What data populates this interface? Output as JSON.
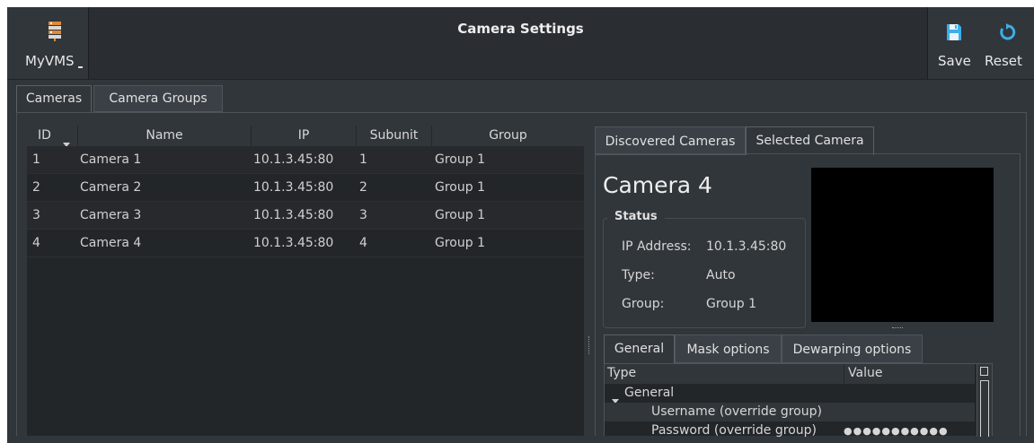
{
  "window": {
    "title": "Camera Settings"
  },
  "toolbar": {
    "app_label": "MyVMS",
    "app_icon": "server-stack-icon",
    "save_label": "Save",
    "save_icon": "floppy-save-icon",
    "reset_label": "Reset",
    "reset_icon": "reset-arrow-icon"
  },
  "main_tabs": [
    {
      "label": "Cameras",
      "active": true
    },
    {
      "label": "Camera Groups",
      "active": false
    }
  ],
  "cameras_table": {
    "columns": [
      "ID",
      "Name",
      "IP",
      "Subunit",
      "Group"
    ],
    "sort_indicator": "chevron-down-icon",
    "rows": [
      [
        "1",
        "Camera 1",
        "10.1.3.45:80",
        "1",
        "Group 1"
      ],
      [
        "2",
        "Camera 2",
        "10.1.3.45:80",
        "2",
        "Group 1"
      ],
      [
        "3",
        "Camera 3",
        "10.1.3.45:80",
        "3",
        "Group 1"
      ],
      [
        "4",
        "Camera 4",
        "10.1.3.45:80",
        "4",
        "Group 1"
      ]
    ]
  },
  "right_tabs": [
    {
      "label": "Discovered Cameras",
      "active": false
    },
    {
      "label": "Selected Camera",
      "active": true
    }
  ],
  "selected_camera": {
    "name": "Camera 4",
    "status_title": "Status",
    "fields": [
      {
        "label": "IP Address:",
        "value": "10.1.3.45:80"
      },
      {
        "label": "Type:",
        "value": "Auto"
      },
      {
        "label": "Group:",
        "value": "Group 1"
      }
    ]
  },
  "detail_tabs": [
    {
      "label": "General",
      "active": true
    },
    {
      "label": "Mask options",
      "active": false
    },
    {
      "label": "Dewarping options",
      "active": false
    }
  ],
  "properties": {
    "columns": [
      "Type",
      "Value"
    ],
    "group": "General",
    "rows": [
      {
        "label": "Username (override group)",
        "value": ""
      },
      {
        "label": "Password (override group)",
        "value": "●●●●●●●●●●●"
      }
    ]
  },
  "colors": {
    "window_bg": "#31363b",
    "table_bg": "#232629",
    "text": "#d6d6d6",
    "preview_bg": "#000000"
  }
}
